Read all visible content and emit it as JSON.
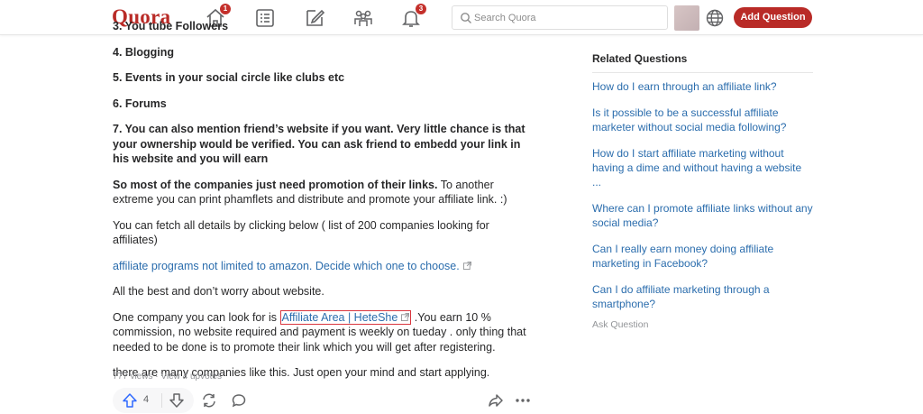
{
  "header": {
    "logo": "Quora",
    "home_badge": "1",
    "notifications_badge": "3",
    "search_placeholder": "Search Quora",
    "add_question": "Add Question"
  },
  "answer": {
    "clipped_item": "3. You tube Followers",
    "item4": "4. Blogging",
    "item5": "5. Events in your social circle like clubs etc",
    "item6": "6. Forums",
    "item7": "7. You can also mention friend’s website if you want. Very little chance is that your ownership would be verified. You can ask friend to embedd your link in his website and you will earn",
    "promo_bold": "So most of the companies just need promotion of their links.",
    "promo_rest": " To another extreme you can print phamflets and distribute and promote your affiliate link. :)",
    "fetch_text": "You can fetch all details by clicking below ( list of 200 companies looking for affiliates)",
    "affiliate_link": "affiliate programs not limited to amazon. Decide which one to choose.",
    "best_text": "All the best and don’t worry about website.",
    "company_pre": "One company you can look for is ",
    "company_link": "Affiliate Area | HeteShe",
    "company_post": " .You earn 10 % commission, no website required and payment is weekly on tueday . only thing that needed to be done is to promote their link which you will get after registering.",
    "closing": "there are many companies like this. Just open your mind and start applying.",
    "meta": "777 views · View 4 upvotes",
    "upvote_count": "4"
  },
  "sidebar": {
    "title": "Related Questions",
    "questions": [
      "How do I earn through an affiliate link?",
      "Is it possible to be a successful affiliate marketer without social media following?",
      "How do I start affiliate marketing without having a dime and without having a website ...",
      "Where can I promote affiliate links without any social media?",
      "Can I really earn money doing affiliate marketing in Facebook?",
      "Can I do affiliate marketing through a smartphone?"
    ],
    "ask_question": "Ask Question"
  },
  "colors": {
    "brand": "#b92b27",
    "link": "#2b6dad",
    "highlight_box": "#d9363e"
  }
}
